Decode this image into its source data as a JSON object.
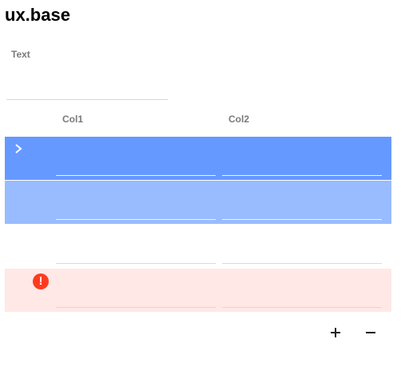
{
  "app": {
    "title": "ux.base"
  },
  "form": {
    "text_label": "Text",
    "text_value": ""
  },
  "table": {
    "columns": [
      "Col1",
      "Col2"
    ],
    "rows": [
      {
        "state": "expanded-selected",
        "icon": "chevron-right-icon",
        "col1": "",
        "col2": ""
      },
      {
        "state": "selected-light",
        "icon": "",
        "col1": "",
        "col2": ""
      },
      {
        "state": "normal",
        "icon": "",
        "col1": "",
        "col2": ""
      },
      {
        "state": "error",
        "icon": "error-icon",
        "col1": "",
        "col2": ""
      }
    ]
  },
  "controls": {
    "add_label": "+",
    "remove_label": "−"
  },
  "colors": {
    "row_selected": "#6699ff",
    "row_selected_light": "#99bbff",
    "row_error": "#ffe8e6",
    "error_icon": "#ff3b1f"
  }
}
